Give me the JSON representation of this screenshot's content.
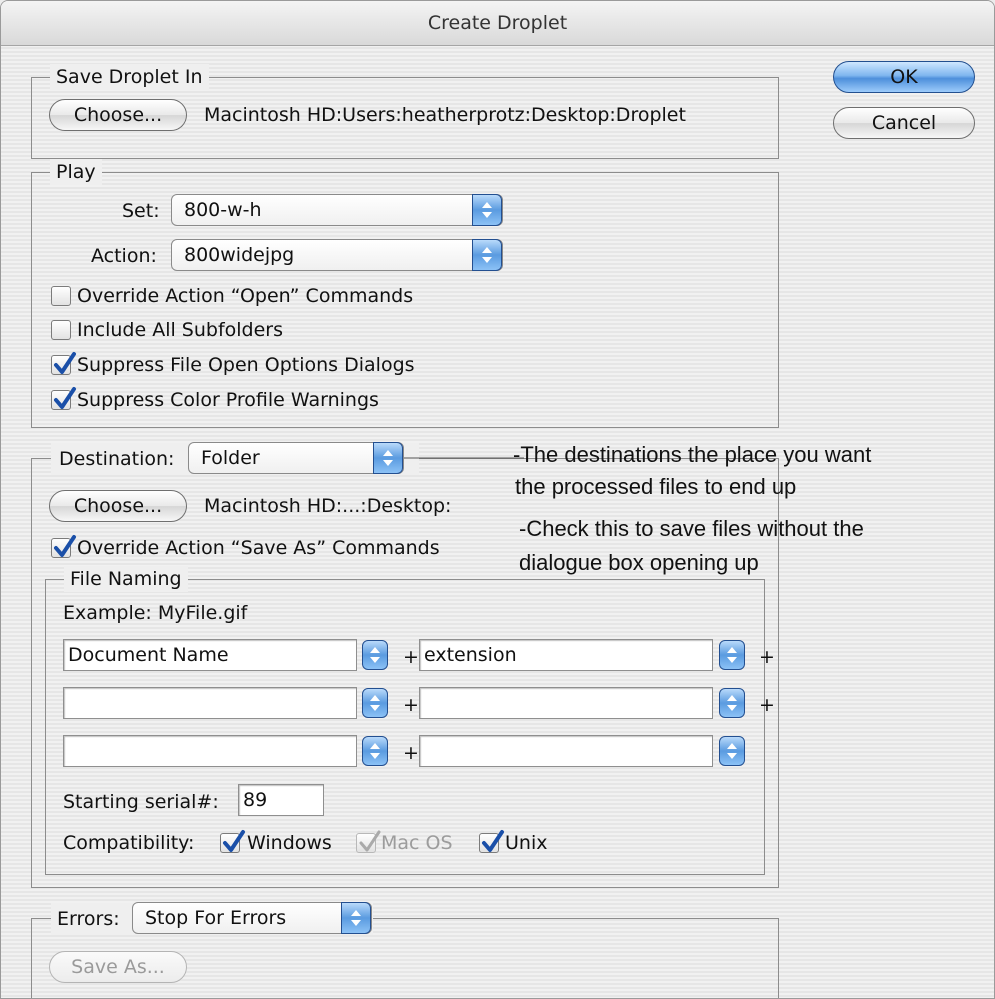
{
  "window": {
    "title": "Create Droplet"
  },
  "save_droplet": {
    "legend": "Save Droplet In",
    "choose_label": "Choose...",
    "path": "Macintosh HD:Users:heatherprotz:Desktop:Droplet"
  },
  "buttons": {
    "ok": "OK",
    "cancel": "Cancel"
  },
  "play": {
    "legend": "Play",
    "set_label": "Set:",
    "set_value": "800-w-h",
    "action_label": "Action:",
    "action_value": "800widejpg",
    "options": [
      {
        "label": "Override Action “Open” Commands",
        "checked": false
      },
      {
        "label": "Include All Subfolders",
        "checked": false
      },
      {
        "label": "Suppress File Open Options Dialogs",
        "checked": true
      },
      {
        "label": "Suppress Color Profile Warnings",
        "checked": true
      }
    ]
  },
  "destination": {
    "label": "Destination:",
    "value": "Folder",
    "choose_label": "Choose...",
    "path": "Macintosh HD:...:Desktop:",
    "override_label": "Override Action “Save As” Commands",
    "override_checked": true,
    "file_naming": {
      "legend": "File Naming",
      "example": "Example: MyFile.gif",
      "rows": [
        {
          "left": "Document Name",
          "right": "extension",
          "trailing_plus": "+"
        },
        {
          "left": "",
          "right": "",
          "trailing_plus": "+"
        },
        {
          "left": "",
          "right": "",
          "trailing_plus": ""
        }
      ],
      "plus": "+",
      "serial_label": "Starting serial#:",
      "serial_value": "89",
      "compat_label": "Compatibility:",
      "compat": [
        {
          "label": "Windows",
          "checked": true,
          "enabled": true
        },
        {
          "label": "Mac OS",
          "checked": true,
          "enabled": false
        },
        {
          "label": "Unix",
          "checked": true,
          "enabled": true
        }
      ]
    }
  },
  "errors": {
    "label": "Errors:",
    "value": "Stop For Errors",
    "save_as_label": "Save As..."
  },
  "annotations": {
    "dest_line1": "-The destinations the place  you want",
    "dest_line2": "the processed files to end up",
    "check_line1": "-Check this to save files without the",
    "check_line2": "dialogue box opening up"
  },
  "colors": {
    "accent": "#4d8fdb",
    "check": "#1a4fa8"
  }
}
